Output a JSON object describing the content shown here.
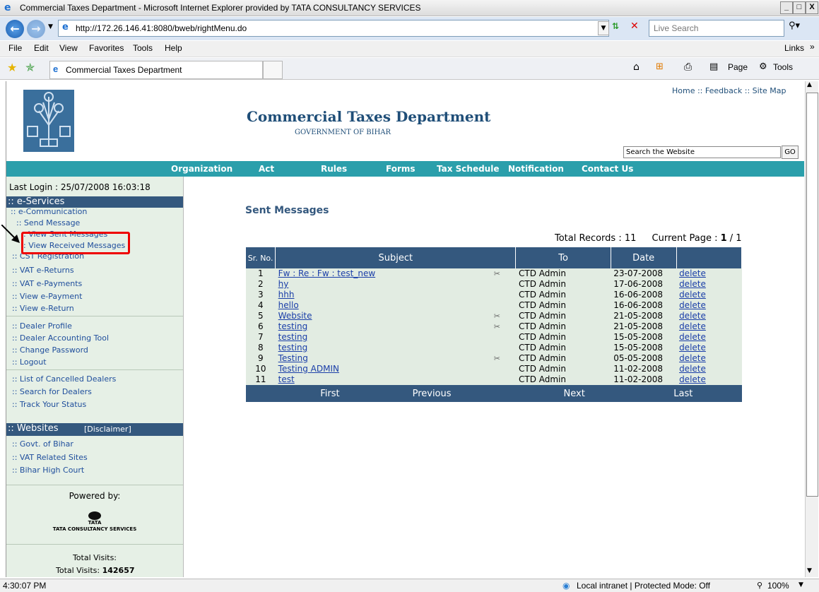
{
  "window": {
    "title": "Commercial Taxes Department - Microsoft Internet Explorer provided by TATA CONSULTANCY SERVICES",
    "min": "_",
    "max": "□",
    "close": "X"
  },
  "address": {
    "url": "http://172.26.146.41:8080/bweb/rightMenu.do",
    "search_placeholder": "Live Search"
  },
  "menu": [
    "File",
    "Edit",
    "View",
    "Favorites",
    "Tools",
    "Help"
  ],
  "links_label": "Links",
  "tab": {
    "title": "Commercial Taxes Department"
  },
  "toolbar": {
    "page": "Page",
    "tools": "Tools"
  },
  "site": {
    "title": "Commercial Taxes Department",
    "subtitle": "GOVERNMENT OF BIHAR",
    "top_links": "Home :: Feedback :: Site Map",
    "search_value": "Search the Website",
    "go": "GO",
    "nav": [
      "Organization",
      "Act",
      "Rules",
      "Forms",
      "Tax Schedule",
      "Notification",
      "Contact Us"
    ]
  },
  "left": {
    "last_login": "Last Login : 25/07/2008 16:03:18",
    "eservices_header": ":: e-Services",
    "ecomm": ":: e-Communication",
    "send_message": ":: Send Message",
    "view_sent": ": View Sent Messages",
    "view_received": ": View Received Messages",
    "group1": [
      ":: CST Registration",
      ":: VAT e-Returns",
      ":: VAT e-Payments",
      ":: View e-Payment",
      ":: View e-Return"
    ],
    "group2": [
      ":: Dealer Profile",
      ":: Dealer Accounting Tool",
      ":: Change Password",
      ":: Logout"
    ],
    "group3": [
      ":: List of Cancelled Dealers",
      ":: Search for Dealers",
      ":: Track Your Status"
    ],
    "websites_header": ":: Websites",
    "disclaimer": "[Disclaimer]",
    "sites": [
      ":: Govt. of Bihar",
      ":: VAT Related Sites",
      ":: Bihar High Court"
    ],
    "powered_by": "Powered by:",
    "tata": "TATA",
    "tcs": "TATA CONSULTANCY SERVICES",
    "total_visits_label": "Total Visits:",
    "total_visits_line": "Total Visits:",
    "total_visits_value": "142657"
  },
  "main": {
    "heading": "Sent Messages",
    "total_records": "Total Records : 11",
    "current_page_label": "Current Page :",
    "current_page": "1",
    "total_pages": "/ 1",
    "columns": [
      "Sr. No.",
      "Subject",
      "To",
      "Date",
      ""
    ],
    "rows": [
      {
        "sr": "1",
        "subject": "Fw : Re : Fw : test_new",
        "attach": true,
        "to": "CTD Admin",
        "date": "23-07-2008",
        "action": "delete"
      },
      {
        "sr": "2",
        "subject": "hy",
        "attach": false,
        "to": "CTD Admin",
        "date": "17-06-2008",
        "action": "delete"
      },
      {
        "sr": "3",
        "subject": "hhh",
        "attach": false,
        "to": "CTD Admin",
        "date": "16-06-2008",
        "action": "delete"
      },
      {
        "sr": "4",
        "subject": "hello",
        "attach": false,
        "to": "CTD Admin",
        "date": "16-06-2008",
        "action": "delete"
      },
      {
        "sr": "5",
        "subject": "Website",
        "attach": true,
        "to": "CTD Admin",
        "date": "21-05-2008",
        "action": "delete"
      },
      {
        "sr": "6",
        "subject": "testing",
        "attach": true,
        "to": "CTD Admin",
        "date": "21-05-2008",
        "action": "delete"
      },
      {
        "sr": "7",
        "subject": "testing",
        "attach": false,
        "to": "CTD Admin",
        "date": "15-05-2008",
        "action": "delete"
      },
      {
        "sr": "8",
        "subject": "testing",
        "attach": false,
        "to": "CTD Admin",
        "date": "15-05-2008",
        "action": "delete"
      },
      {
        "sr": "9",
        "subject": "Testing",
        "attach": true,
        "to": "CTD Admin",
        "date": "05-05-2008",
        "action": "delete"
      },
      {
        "sr": "10",
        "subject": "Testing ADMIN",
        "attach": false,
        "to": "CTD Admin",
        "date": "11-02-2008",
        "action": "delete"
      },
      {
        "sr": "11",
        "subject": "test",
        "attach": false,
        "to": "CTD Admin",
        "date": "11-02-2008",
        "action": "delete"
      }
    ],
    "pager": [
      "First",
      "Previous",
      "Next",
      "Last"
    ]
  },
  "status": {
    "time": "4:30:07 PM",
    "zone": "Local intranet | Protected Mode: Off",
    "zoom": "100%"
  },
  "colors": {
    "header_blue": "#34587e",
    "teal": "#2b9fab",
    "panel_green": "#e6f0e6",
    "highlight_red": "#e00000"
  }
}
